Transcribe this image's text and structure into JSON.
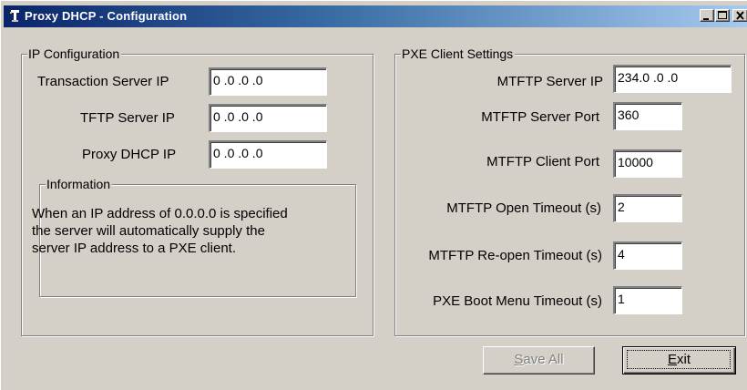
{
  "window": {
    "title": "Proxy DHCP - Configuration",
    "controls": [
      "minimize",
      "maximize",
      "close"
    ]
  },
  "ip_configuration": {
    "legend": "IP Configuration",
    "fields": [
      {
        "label": "Transaction Server IP",
        "value": "0  .0  .0  .0"
      },
      {
        "label": "TFTP Server IP",
        "value": "0  .0  .0  .0"
      },
      {
        "label": "Proxy DHCP IP",
        "value": "0  .0  .0  .0"
      }
    ],
    "information": {
      "legend": "Information",
      "lines": [
        "When an IP address of 0.0.0.0 is specified",
        "the server will automatically supply the",
        "server IP address to a PXE client."
      ]
    }
  },
  "pxe_client_settings": {
    "legend": "PXE Client Settings",
    "fields": [
      {
        "label": "MTFTP Server IP",
        "value": "234.0  .0  .0"
      },
      {
        "label": "MTFTP Server Port",
        "value": "360"
      },
      {
        "label": "MTFTP Client Port",
        "value": "10000"
      },
      {
        "label": "MTFTP Open Timeout (s)",
        "value": "2"
      },
      {
        "label": "MTFTP Re-open Timeout (s)",
        "value": "4"
      },
      {
        "label": "PXE Boot Menu Timeout (s)",
        "value": "1"
      }
    ]
  },
  "buttons": {
    "save_all": {
      "label_first": "S",
      "label_rest": "ave All",
      "enabled": false
    },
    "exit": {
      "label_first": "E",
      "label_rest": "xit",
      "enabled": true
    }
  },
  "colors": {
    "dialog_face": "#d4d0c8",
    "title_gradient_start": "#0a246a",
    "title_gradient_end": "#a6caf0",
    "disabled_text": "#808080"
  }
}
